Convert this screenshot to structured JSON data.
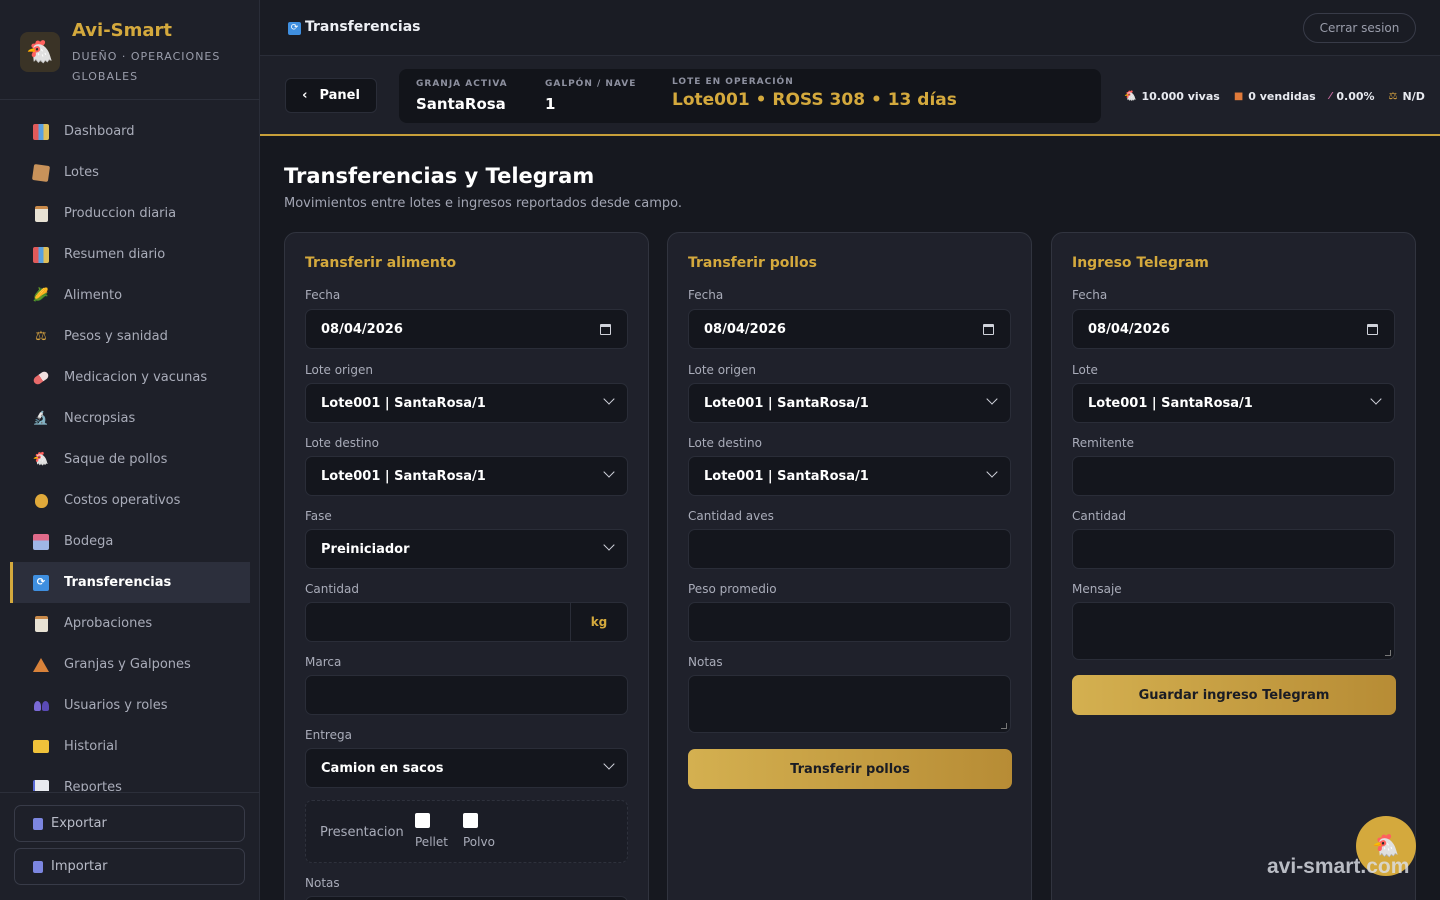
{
  "brand": {
    "title": "Avi-Smart",
    "subtitle": "DUEÑO · OPERACIONES GLOBALES",
    "logo_icon": "chicken-icon"
  },
  "sidebar": {
    "items": [
      {
        "label": "Dashboard",
        "icon": "bar-chart-icon"
      },
      {
        "label": "Lotes",
        "icon": "box-icon"
      },
      {
        "label": "Produccion diaria",
        "icon": "clipboard-icon"
      },
      {
        "label": "Resumen diario",
        "icon": "bar-chart-icon"
      },
      {
        "label": "Alimento",
        "icon": "corn-icon"
      },
      {
        "label": "Pesos y sanidad",
        "icon": "scale-icon"
      },
      {
        "label": "Medicacion y vacunas",
        "icon": "pill-icon"
      },
      {
        "label": "Necropsias",
        "icon": "microscope-icon"
      },
      {
        "label": "Saque de pollos",
        "icon": "chicken-icon"
      },
      {
        "label": "Costos operativos",
        "icon": "money-bag-icon"
      },
      {
        "label": "Bodega",
        "icon": "warehouse-icon"
      },
      {
        "label": "Transferencias",
        "icon": "transfer-icon",
        "active": true
      },
      {
        "label": "Aprobaciones",
        "icon": "clipboard-icon"
      },
      {
        "label": "Granjas y Galpones",
        "icon": "house-icon"
      },
      {
        "label": "Usuarios y roles",
        "icon": "users-icon"
      },
      {
        "label": "Historial",
        "icon": "folder-icon"
      },
      {
        "label": "Reportes",
        "icon": "line-chart-icon"
      }
    ],
    "export_label": "Exportar",
    "import_label": "Importar"
  },
  "topbar": {
    "title": "Transferencias",
    "logout_label": "Cerrar sesion"
  },
  "context": {
    "back_label": "Panel",
    "granja_label": "GRANJA ACTIVA",
    "granja_value": "SantaRosa",
    "galpon_label": "GALPÓN / NAVE",
    "galpon_value": "1",
    "lote_label": "LOTE EN OPERACIÓN",
    "lote_value": "Lote001 • ROSS 308 • 13 días",
    "stats": {
      "vivas": "10.000 vivas",
      "vendidas": "0 vendidas",
      "porcentaje": "0.00%",
      "nd": "N/D"
    }
  },
  "page": {
    "title": "Transferencias y Telegram",
    "subtitle": "Movimientos entre lotes e ingresos reportados desde campo."
  },
  "alimento": {
    "title": "Transferir alimento",
    "fecha_label": "Fecha",
    "fecha_value": "08/04/2026",
    "origen_label": "Lote origen",
    "origen_value": "Lote001 | SantaRosa/1",
    "destino_label": "Lote destino",
    "destino_value": "Lote001 | SantaRosa/1",
    "fase_label": "Fase",
    "fase_value": "Preiniciador",
    "cantidad_label": "Cantidad",
    "cantidad_unit": "kg",
    "marca_label": "Marca",
    "entrega_label": "Entrega",
    "entrega_value": "Camion en sacos",
    "presentacion_label": "Presentacion",
    "pellet_label": "Pellet",
    "polvo_label": "Polvo",
    "notas_label": "Notas"
  },
  "pollos": {
    "title": "Transferir pollos",
    "fecha_label": "Fecha",
    "fecha_value": "08/04/2026",
    "origen_label": "Lote origen",
    "origen_value": "Lote001 | SantaRosa/1",
    "destino_label": "Lote destino",
    "destino_value": "Lote001 | SantaRosa/1",
    "cantidad_label": "Cantidad aves",
    "peso_label": "Peso promedio",
    "notas_label": "Notas",
    "submit_label": "Transferir pollos"
  },
  "telegram": {
    "title": "Ingreso Telegram",
    "fecha_label": "Fecha",
    "fecha_value": "08/04/2026",
    "lote_label": "Lote",
    "lote_value": "Lote001 | SantaRosa/1",
    "remitente_label": "Remitente",
    "cantidad_label": "Cantidad",
    "mensaje_label": "Mensaje",
    "submit_label": "Guardar ingreso Telegram"
  },
  "watermark": "avi-smart.com",
  "colors": {
    "accent": "#d4a93d",
    "background": "#16181f",
    "panel": "#1f212b"
  }
}
